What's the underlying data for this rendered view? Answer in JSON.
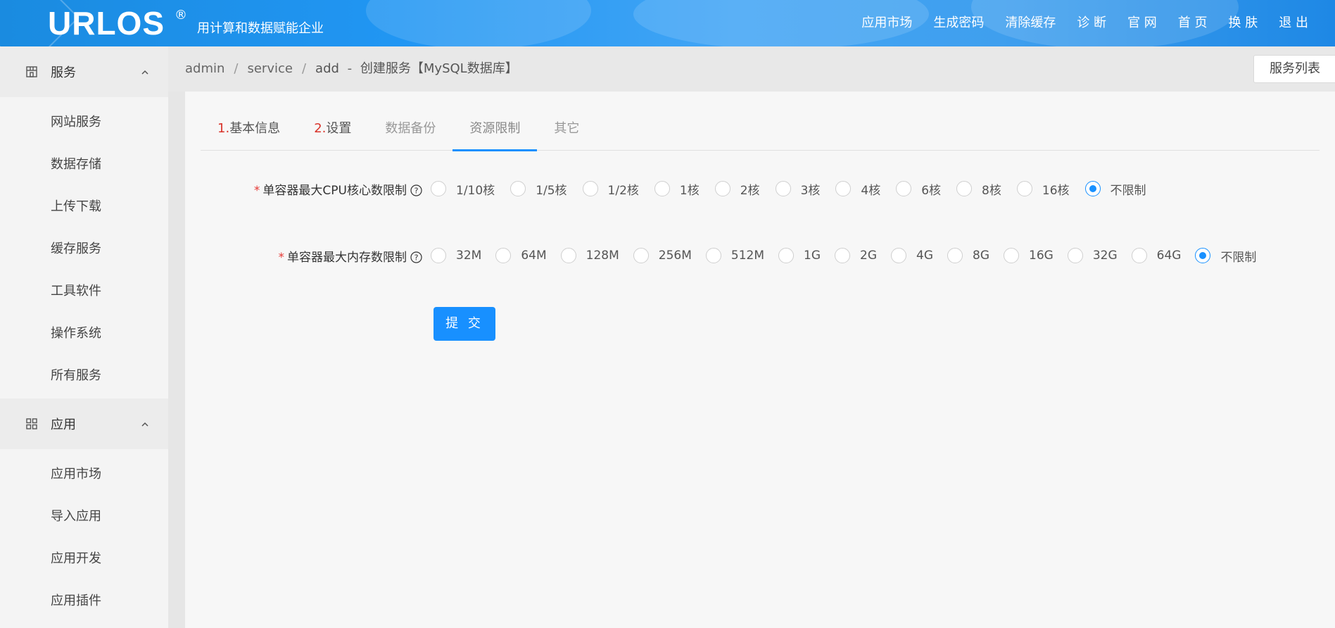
{
  "header": {
    "logo": "URLOS",
    "logo_mark": "®",
    "slogan": "用计算和数据赋能企业",
    "nav": [
      "应用市场",
      "生成密码",
      "清除缓存",
      "诊 断",
      "官 网",
      "首 页",
      "换 肤",
      "退 出"
    ]
  },
  "sidebar": {
    "groups": [
      {
        "label": "服务",
        "icon": "store-icon",
        "expanded": true,
        "items": [
          "网站服务",
          "数据存储",
          "上传下载",
          "缓存服务",
          "工具软件",
          "操作系统",
          "所有服务"
        ]
      },
      {
        "label": "应用",
        "icon": "grid-icon",
        "expanded": true,
        "items": [
          "应用市场",
          "导入应用",
          "应用开发",
          "应用插件"
        ]
      }
    ]
  },
  "breadcrumb": {
    "parts": [
      "admin",
      "service",
      "add"
    ],
    "dash": "-",
    "current": "创建服务【MySQL数据库】"
  },
  "list_button": "服务列表",
  "tabs": [
    {
      "num": "1.",
      "label": "基本信息",
      "state": "done"
    },
    {
      "num": "2.",
      "label": "设置",
      "state": "done"
    },
    {
      "num": "",
      "label": "数据备份",
      "state": "normal"
    },
    {
      "num": "",
      "label": "资源限制",
      "state": "active"
    },
    {
      "num": "",
      "label": "其它",
      "state": "normal"
    }
  ],
  "form": {
    "required_mark": "*",
    "cpu": {
      "label": "单容器最大CPU核心数限制",
      "options": [
        "1/10核",
        "1/5核",
        "1/2核",
        "1核",
        "2核",
        "3核",
        "4核",
        "6核",
        "8核",
        "16核",
        "不限制"
      ],
      "selected": "不限制"
    },
    "memory": {
      "label": "单容器最大内存数限制",
      "options": [
        "32M",
        "64M",
        "128M",
        "256M",
        "512M",
        "1G",
        "2G",
        "4G",
        "8G",
        "16G",
        "32G",
        "64G",
        "不限制"
      ],
      "selected": "不限制"
    },
    "submit": "提 交"
  },
  "colors": {
    "accent": "#1890ff",
    "required": "#e53935",
    "tab_number": "#d9342b"
  }
}
